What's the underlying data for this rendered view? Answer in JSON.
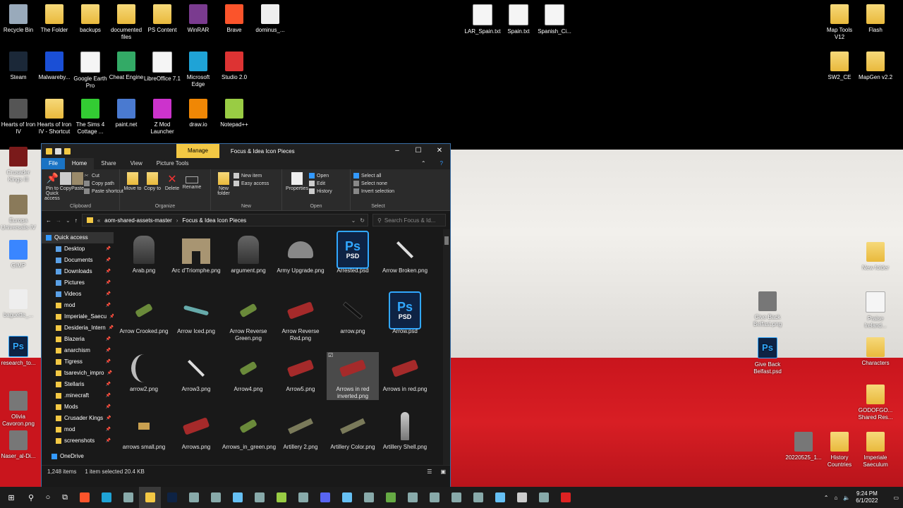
{
  "desktop": {
    "icons_top": [
      {
        "label": "Recycle Bin",
        "icon": "recycle-bin-icon"
      },
      {
        "label": "The Folder",
        "icon": "folder-icon"
      },
      {
        "label": "backups",
        "icon": "folder-icon"
      },
      {
        "label": "documented files",
        "icon": "folder-icon"
      },
      {
        "label": "PS Content",
        "icon": "folder-icon"
      },
      {
        "label": "WinRAR",
        "icon": "winrar-icon"
      },
      {
        "label": "Brave",
        "icon": "brave-icon"
      },
      {
        "label": "dominus_...",
        "icon": "media-file-icon"
      }
    ],
    "icons_row2": [
      {
        "label": "Steam",
        "icon": "steam-icon"
      },
      {
        "label": "Malwareby...",
        "icon": "malwarebytes-icon"
      },
      {
        "label": "Google Earth Pro",
        "icon": "document-icon"
      },
      {
        "label": "Cheat Engine",
        "icon": "cheat-engine-icon"
      },
      {
        "label": "LibreOffice 7.1",
        "icon": "document-icon"
      },
      {
        "label": "Microsoft Edge",
        "icon": "edge-icon"
      },
      {
        "label": "Studio 2.0",
        "icon": "studio-icon"
      }
    ],
    "icons_row3": [
      {
        "label": "Hearts of Iron IV",
        "icon": "hoi4-icon"
      },
      {
        "label": "Hearts of Iron IV - Shortcut",
        "icon": "folder-icon"
      },
      {
        "label": "The Sims 4 Cottage ...",
        "icon": "sims-icon"
      },
      {
        "label": "paint.net",
        "icon": "paintnet-icon"
      },
      {
        "label": "Z Mod Launcher",
        "icon": "zmod-icon"
      },
      {
        "label": "draw.io",
        "icon": "drawio-icon"
      },
      {
        "label": "Notepad++",
        "icon": "notepadpp-icon"
      }
    ],
    "icons_left": [
      {
        "label": "Crusader Kings III",
        "icon": "ck3-icon"
      },
      {
        "label": "Europa Universalis IV",
        "icon": "eu4-icon"
      },
      {
        "label": "GIMP",
        "icon": "gimp-icon"
      },
      {
        "label": "baguette_...",
        "icon": "media-file-icon"
      },
      {
        "label": "research_to...",
        "icon": "psd-icon"
      },
      {
        "label": "Olivia Cavoron.png",
        "icon": "image-icon"
      },
      {
        "label": "Naser_al-Di...",
        "icon": "image-icon"
      }
    ],
    "icons_txt": [
      {
        "label": "LAR_Spain.txt"
      },
      {
        "label": "Spain.txt"
      },
      {
        "label": "Spanish_Ci..."
      }
    ],
    "icons_right": [
      {
        "label": "Map Tools V12",
        "icon": "folder-icon"
      },
      {
        "label": "Flash",
        "icon": "folder-icon"
      },
      {
        "label": "SW2_CE",
        "icon": "folder-icon"
      },
      {
        "label": "MapGen v2.2",
        "icon": "folder-icon"
      },
      {
        "label": "New folder",
        "icon": "folder-icon"
      },
      {
        "label": "Give Back Belfast.png",
        "icon": "image-icon"
      },
      {
        "label": "Praise Ireland...",
        "icon": "document-icon"
      },
      {
        "label": "Give Back Belfast.psd",
        "icon": "psd-icon"
      },
      {
        "label": "Characters",
        "icon": "folder-icon"
      },
      {
        "label": "GODOFGO... Shared Res...",
        "icon": "folder-icon"
      },
      {
        "label": "20220525_1...",
        "icon": "image-icon"
      },
      {
        "label": "History Countries",
        "icon": "folder-icon"
      },
      {
        "label": "Imperiale Saeculum",
        "icon": "folder-icon"
      }
    ]
  },
  "explorer": {
    "manage_tab": "Manage",
    "title": "Focus & Idea Icon Pieces",
    "tabs": [
      "File",
      "Home",
      "Share",
      "View",
      "Picture Tools"
    ],
    "ribbon": {
      "clipboard": {
        "label": "Clipboard",
        "pin": "Pin to Quick access",
        "copy": "Copy",
        "paste": "Paste",
        "cut": "Cut",
        "copy_path": "Copy path",
        "paste_shortcut": "Paste shortcut"
      },
      "organize": {
        "label": "Organize",
        "move_to": "Move to",
        "copy_to": "Copy to",
        "delete": "Delete",
        "rename": "Rename"
      },
      "new": {
        "label": "New",
        "new_folder": "New folder",
        "new_item": "New item",
        "easy_access": "Easy access"
      },
      "open": {
        "label": "Open",
        "properties": "Properties",
        "open": "Open",
        "edit": "Edit",
        "history": "History"
      },
      "select": {
        "label": "Select",
        "select_all": "Select all",
        "select_none": "Select none",
        "invert": "Invert selection"
      }
    },
    "breadcrumb": [
      "aom-shared-assets-master",
      "Focus & Idea Icon Pieces"
    ],
    "search_placeholder": "Search Focus & Id...",
    "nav": [
      "Quick access",
      "Desktop",
      "Documents",
      "Downloads",
      "Pictures",
      "Videos",
      "mod",
      "Imperiale_Saecu",
      "Desideria_Intern",
      "Blazeria",
      "anarchism",
      "Tigress",
      "tsarevich_impro",
      "Stellaris",
      ".minecraft",
      "Mods",
      "Crusader Kings",
      "mod",
      "screenshots",
      "OneDrive"
    ],
    "files": [
      {
        "name": "Arab.png",
        "kind": "photo"
      },
      {
        "name": "Arc d'Triomphe.png",
        "kind": "arch"
      },
      {
        "name": "argument.png",
        "kind": "photo"
      },
      {
        "name": "Army Upgrade.png",
        "kind": "helmet"
      },
      {
        "name": "Arrested.psd",
        "kind": "psd"
      },
      {
        "name": "Arrow Broken.png",
        "kind": "arrow"
      },
      {
        "name": "Arrow Crooked.png",
        "kind": "green"
      },
      {
        "name": "Arrow Iced.png",
        "kind": "ice"
      },
      {
        "name": "Arrow Reverse Green.png",
        "kind": "green"
      },
      {
        "name": "Arrow Reverse Red.png",
        "kind": "red"
      },
      {
        "name": "arrow.png",
        "kind": "dark"
      },
      {
        "name": "Arrow.psd",
        "kind": "psd"
      },
      {
        "name": "arrow2.png",
        "kind": "curve"
      },
      {
        "name": "Arrow3.png",
        "kind": "arrow"
      },
      {
        "name": "Arrow4.png",
        "kind": "green"
      },
      {
        "name": "Arrow5.png",
        "kind": "red"
      },
      {
        "name": "Arrows in red inverted.png",
        "kind": "red"
      },
      {
        "name": "Arrows in red.png",
        "kind": "red"
      },
      {
        "name": "arrows small.png",
        "kind": "gold"
      },
      {
        "name": "Arrows.png",
        "kind": "red"
      },
      {
        "name": "Arrows_in_green.png",
        "kind": "green"
      },
      {
        "name": "Artillery 2.png",
        "kind": "gun"
      },
      {
        "name": "Artillery Color.png",
        "kind": "gun"
      },
      {
        "name": "Artillery Shell.png",
        "kind": "shell"
      }
    ],
    "status_count": "1,248 items",
    "status_selected": "1 item selected  20.4 KB"
  },
  "taskbar": {
    "time": "9:24 PM",
    "date": "6/1/2022"
  },
  "colors": {
    "accent": "#1a73c4",
    "manage": "#f3c844",
    "flag_red": "#c9151d"
  }
}
